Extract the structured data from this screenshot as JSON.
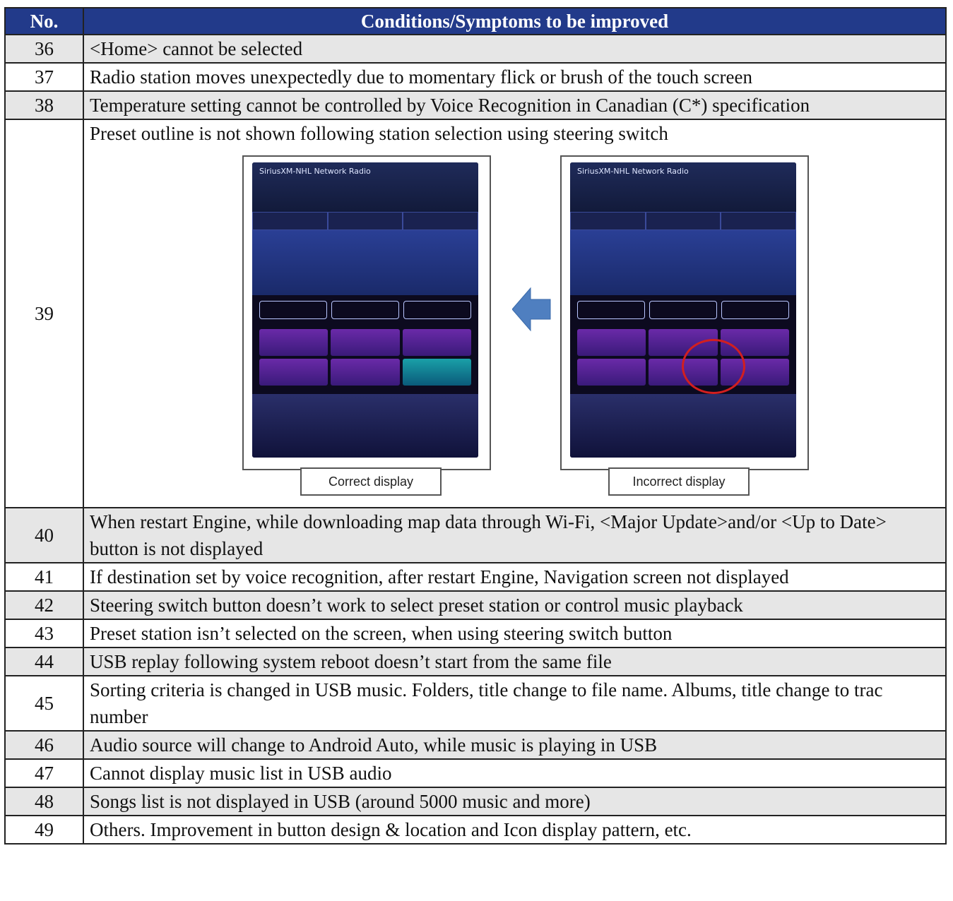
{
  "table": {
    "header": {
      "no": "No.",
      "conditions": "Conditions/Symptoms to be improved"
    },
    "rows": [
      {
        "no": "36",
        "text": "<Home> cannot be selected"
      },
      {
        "no": "37",
        "text": "Radio station moves unexpectedly due to momentary flick or brush of the touch screen"
      },
      {
        "no": "38",
        "text": "Temperature setting cannot be controlled by Voice Recognition in Canadian (C*) specification"
      },
      {
        "no": "39",
        "text": "Preset outline is not shown following station selection using steering switch"
      },
      {
        "no": "40",
        "text": "When restart Engine, while downloading map data through Wi-Fi, <Major Update>and/or <Up to Date> button is not displayed"
      },
      {
        "no": "41",
        "text": "If destination set by voice recognition, after restart Engine, Navigation screen not displayed"
      },
      {
        "no": "42",
        "text": "Steering switch button doesn’t work to select preset station or control music playback"
      },
      {
        "no": "43",
        "text": "Preset station isn’t selected on the screen, when using steering switch button"
      },
      {
        "no": "44",
        "text": "USB replay following system reboot doesn’t start from the same file"
      },
      {
        "no": "45",
        "text": "Sorting criteria is changed in USB music. Folders, title change to file name. Albums, title change to trac number"
      },
      {
        "no": "46",
        "text": "Audio source will change to Android Auto, while music is playing in USB"
      },
      {
        "no": "47",
        "text": "Cannot display music list in USB audio"
      },
      {
        "no": "48",
        "text": "Songs list is not displayed in USB (around 5000 music and more)"
      },
      {
        "no": "49",
        "text": "Others. Improvement in button design & location and Icon display pattern, etc."
      }
    ]
  },
  "figure": {
    "correct_caption": "Correct display",
    "incorrect_caption": "Incorrect display",
    "correct_screen_title": "SiriusXM-NHL Network Radio",
    "incorrect_screen_title": "SiriusXM-NHL Network Radio",
    "arrow_color": "#4f7fc0",
    "highlight_color": "#d21f1f"
  }
}
